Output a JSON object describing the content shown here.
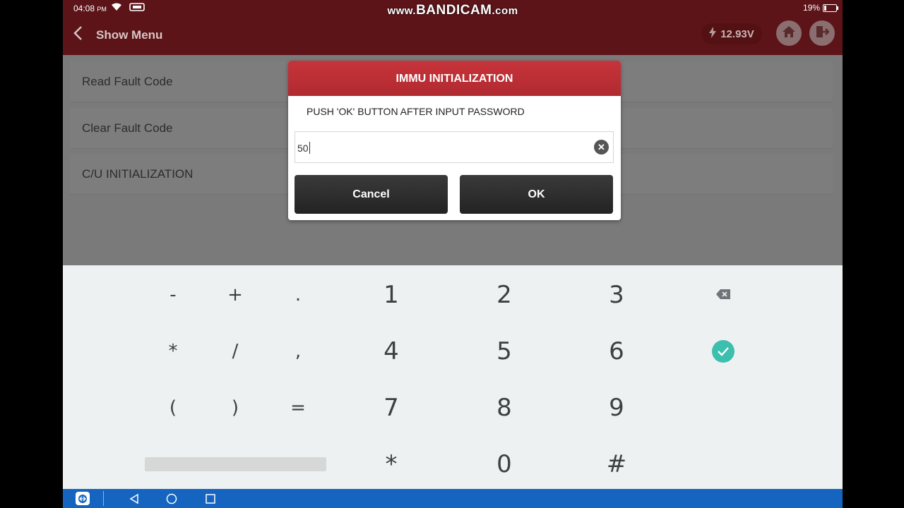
{
  "status_bar": {
    "time": "04:08",
    "ampm": "PM",
    "battery": "19%",
    "battery_level": 0.19
  },
  "watermark": {
    "prefix": "www.",
    "brand": "BANDICAM",
    "suffix": ".com"
  },
  "header": {
    "back_label": "Show Menu",
    "voltage": "12.93V"
  },
  "menu": {
    "items": [
      {
        "label": "Read Fault Code"
      },
      {
        "label": "Clear Fault Code"
      },
      {
        "label": "C/U INITIALIZATION"
      }
    ]
  },
  "dialog": {
    "title": "IMMU INITIALIZATION",
    "message": "PUSH 'OK' BUTTON AFTER INPUT PASSWORD",
    "password_value": "50",
    "cancel_label": "Cancel",
    "ok_label": "OK"
  },
  "keypad": {
    "row1": [
      "-",
      "+",
      ".",
      "1",
      "2",
      "3"
    ],
    "row2": [
      "*",
      "/",
      ",",
      "4",
      "5",
      "6"
    ],
    "row3": [
      "(",
      ")",
      "=",
      "7",
      "8",
      "9"
    ],
    "row4": [
      "*",
      "0",
      "#"
    ]
  },
  "colors": {
    "header": "#5c1418",
    "dialog_title": "#b02a30",
    "done_key": "#3cbfae",
    "navbar": "#1565c0"
  }
}
